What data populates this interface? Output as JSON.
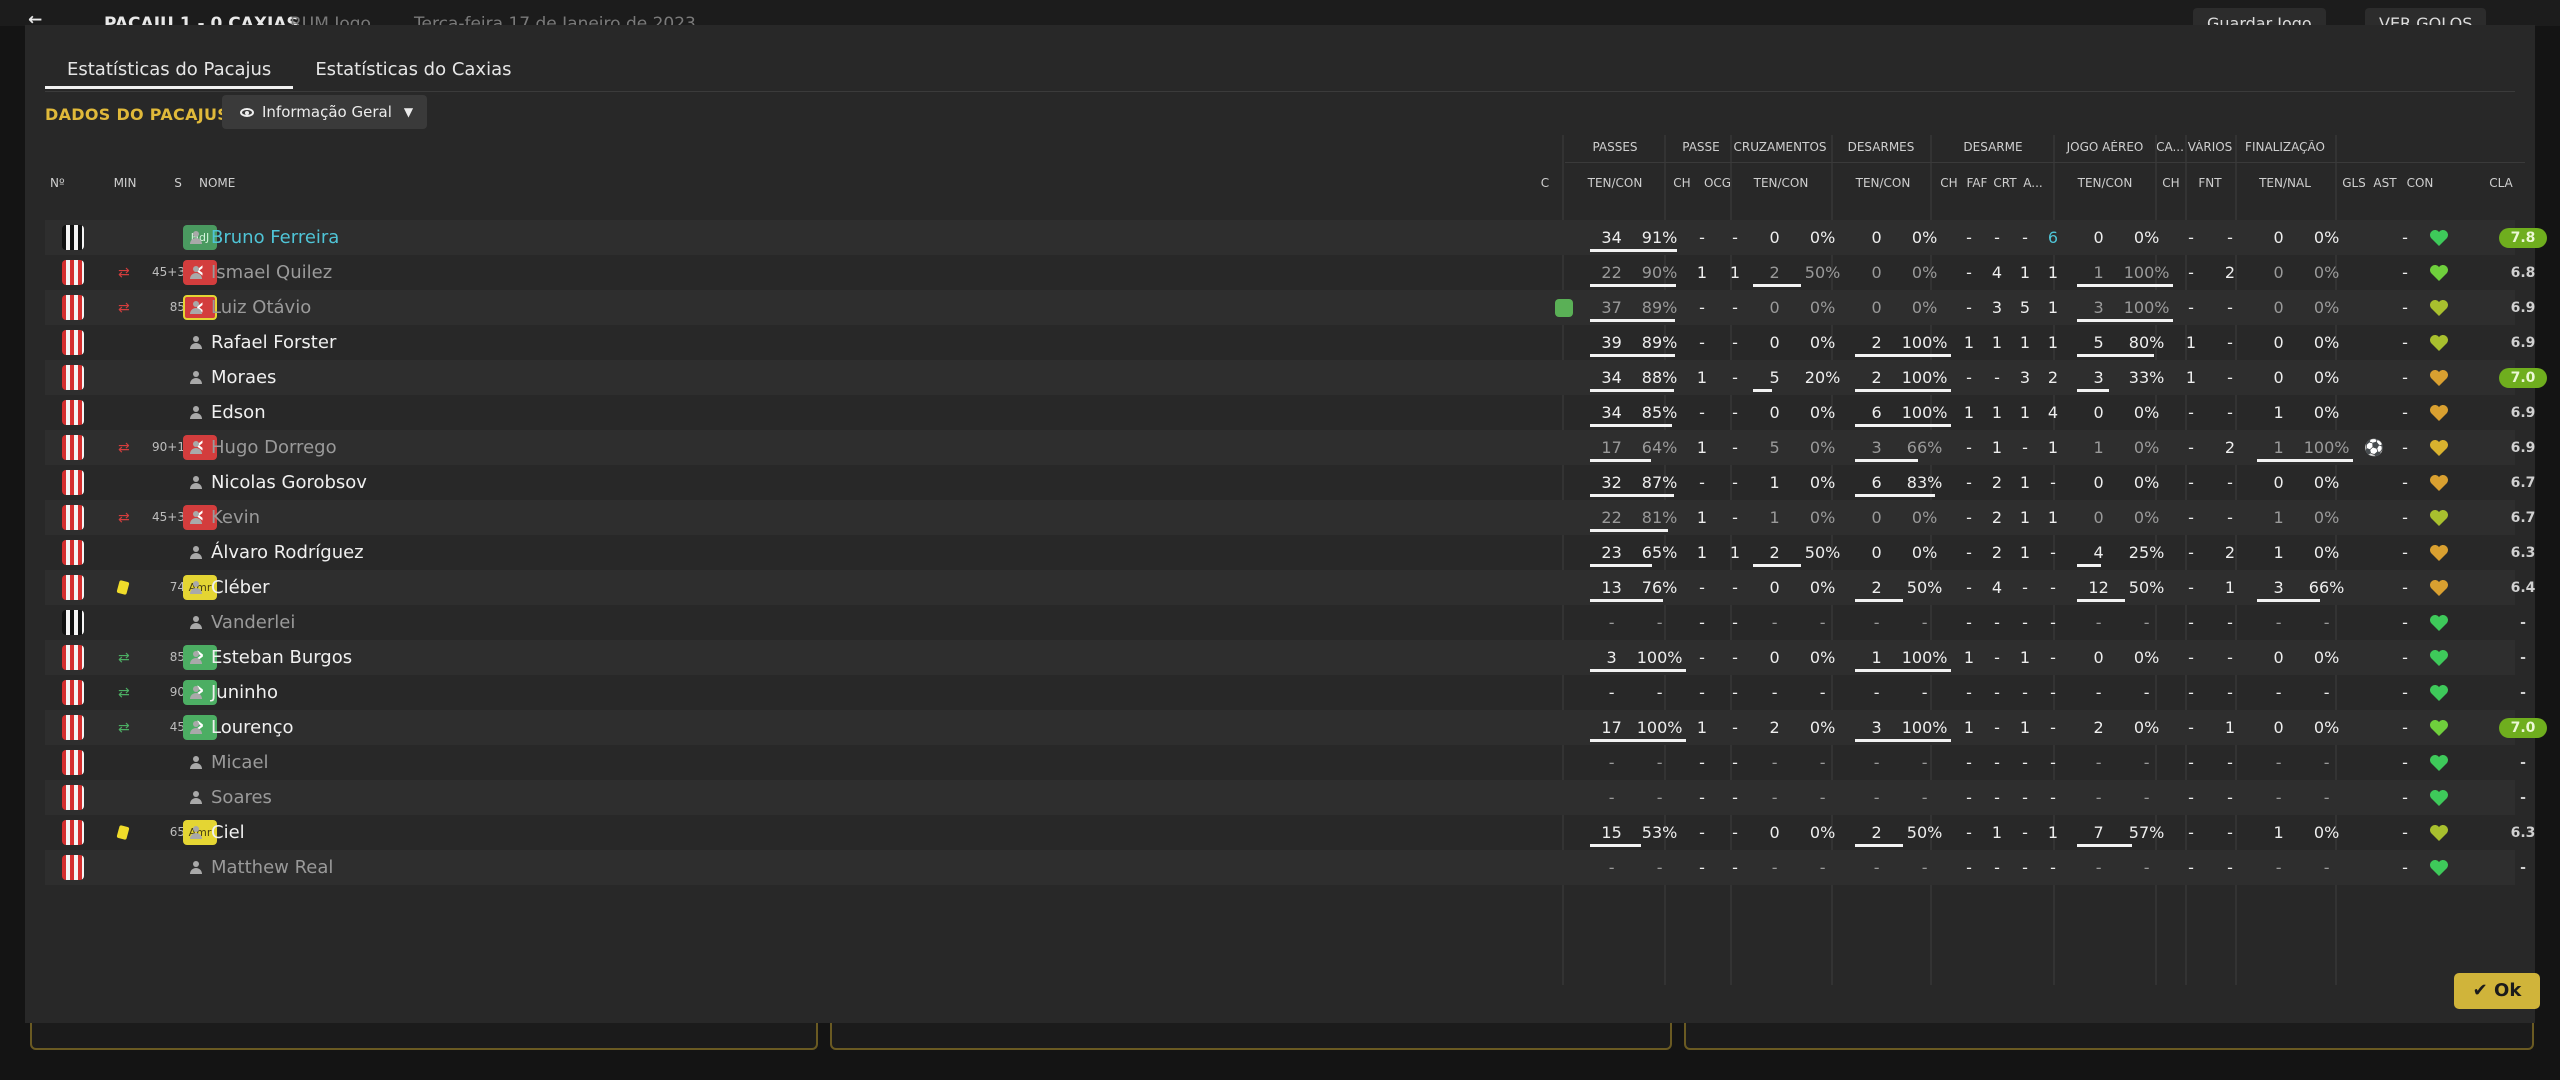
{
  "background": {
    "match_title": "PACAJU 1 - 0 CAXIAS",
    "match_sub": "RUM Jogo",
    "date": "Terça-feira 17 de Janeiro de 2023",
    "save_label": "Guardar Jogo",
    "goals_label": "VER GOLOS"
  },
  "tabs": [
    "Estatísticas do Pacajus",
    "Estatísticas do Caxias"
  ],
  "section_title": "DADOS DO PACAJUS",
  "view_dropdown": "Informação Geral",
  "groups": {
    "passes": "PASSES",
    "passe": "PASSE",
    "cruz": "CRUZAMENTOS",
    "desarmes": "DESARMES",
    "desarme": "DESARME",
    "aereo": "JOGO AÉREO",
    "ca": "CA...",
    "varios": "VÁRIOS",
    "final": "FINALIZAÇÃO"
  },
  "headers": {
    "no": "Nº",
    "min": "MIN",
    "s": "S",
    "nome": "NOME",
    "c": "C",
    "passes": "TEN/CON",
    "ch1": "CH",
    "ocg": "OCG",
    "cruz": "TEN/CON",
    "desarmes": "TEN/CON",
    "ch2": "CH",
    "faf": "FAF",
    "crt": "CRT",
    "a": "A...",
    "aereo": "TEN/CON",
    "ch3": "CH",
    "fnt": "FNT",
    "final": "TEN/NAL",
    "gls": "GLS",
    "ast": "AST",
    "con": "CON",
    "cla": "CLA"
  },
  "players": [
    {
      "name": "Bruno Ferreira",
      "kit": "bw",
      "evt": "",
      "min": "",
      "sb": "HdJ",
      "p": [
        "34",
        "91%"
      ],
      "pf": 0.91,
      "ch": "-",
      "ocg": "-",
      "cr": [
        "0",
        "0%"
      ],
      "crf": 0,
      "ds": [
        "0",
        "0%"
      ],
      "dsf": 0,
      "dch": "-",
      "faf": "-",
      "crt": "-",
      "a": "6",
      "ae": [
        "0",
        "0%"
      ],
      "aef": 0,
      "ca": "-",
      "fnt": "-",
      "fi": [
        "0",
        "0%"
      ],
      "fif": 0,
      "gls": "",
      "ast": "-",
      "heart": "#3ec95a",
      "cla": "7.8",
      "hi": true,
      "style": "link",
      "teal": true
    },
    {
      "name": "Ismael Quilez",
      "kit": "red",
      "evt": "sub",
      "min": "45+3",
      "sb": "out",
      "p": [
        "22",
        "90%"
      ],
      "pf": 0.9,
      "ch": "1",
      "ocg": "1",
      "cr": [
        "2",
        "50%"
      ],
      "crf": 0.5,
      "ds": [
        "0",
        "0%"
      ],
      "dsf": 0,
      "dch": "-",
      "faf": "4",
      "crt": "1",
      "a": "1",
      "ae": [
        "1",
        "100%"
      ],
      "aef": 1,
      "ca": "-",
      "fnt": "2",
      "fi": [
        "0",
        "0%"
      ],
      "fif": 0,
      "gls": "",
      "ast": "-",
      "heart": "#6fcf3c",
      "cla": "6.8",
      "style": "dim"
    },
    {
      "name": "Luiz Otávio",
      "kit": "red",
      "evt": "sub",
      "min": "85",
      "sb": "outy",
      "c": true,
      "p": [
        "37",
        "89%"
      ],
      "pf": 0.89,
      "ch": "-",
      "ocg": "-",
      "cr": [
        "0",
        "0%"
      ],
      "crf": 0,
      "ds": [
        "0",
        "0%"
      ],
      "dsf": 0,
      "dch": "-",
      "faf": "3",
      "crt": "5",
      "a": "1",
      "ae": [
        "3",
        "100%"
      ],
      "aef": 1,
      "ca": "-",
      "fnt": "-",
      "fi": [
        "0",
        "0%"
      ],
      "fif": 0,
      "gls": "",
      "ast": "-",
      "heart": "#a8c02e",
      "cla": "6.9",
      "style": "dim"
    },
    {
      "name": "Rafael Forster",
      "kit": "red",
      "evt": "",
      "min": "",
      "sb": "",
      "p": [
        "39",
        "89%"
      ],
      "pf": 0.89,
      "ch": "-",
      "ocg": "-",
      "cr": [
        "0",
        "0%"
      ],
      "crf": 0,
      "ds": [
        "2",
        "100%"
      ],
      "dsf": 1,
      "dch": "1",
      "faf": "1",
      "crt": "1",
      "a": "1",
      "ae": [
        "5",
        "80%"
      ],
      "aef": 0.8,
      "ca": "1",
      "fnt": "-",
      "fi": [
        "0",
        "0%"
      ],
      "fif": 0,
      "gls": "",
      "ast": "-",
      "heart": "#a8c02e",
      "cla": "6.9",
      "style": ""
    },
    {
      "name": "Moraes",
      "kit": "red",
      "evt": "",
      "min": "",
      "sb": "",
      "p": [
        "34",
        "88%"
      ],
      "pf": 0.88,
      "ch": "1",
      "ocg": "-",
      "cr": [
        "5",
        "20%"
      ],
      "crf": 0.2,
      "ds": [
        "2",
        "100%"
      ],
      "dsf": 1,
      "dch": "-",
      "faf": "-",
      "crt": "3",
      "a": "2",
      "ae": [
        "3",
        "33%"
      ],
      "aef": 0.33,
      "ca": "1",
      "fnt": "-",
      "fi": [
        "0",
        "0%"
      ],
      "fif": 0,
      "gls": "",
      "ast": "-",
      "heart": "#d9a030",
      "cla": "7.0",
      "hi": true,
      "style": ""
    },
    {
      "name": "Edson",
      "kit": "red",
      "evt": "",
      "min": "",
      "sb": "",
      "p": [
        "34",
        "85%"
      ],
      "pf": 0.85,
      "ch": "-",
      "ocg": "-",
      "cr": [
        "0",
        "0%"
      ],
      "crf": 0,
      "ds": [
        "6",
        "100%"
      ],
      "dsf": 1,
      "dch": "1",
      "faf": "1",
      "crt": "1",
      "a": "4",
      "ae": [
        "0",
        "0%"
      ],
      "aef": 0,
      "ca": "-",
      "fnt": "-",
      "fi": [
        "1",
        "0%"
      ],
      "fif": 0,
      "gls": "",
      "ast": "-",
      "heart": "#d9a030",
      "cla": "6.9",
      "style": ""
    },
    {
      "name": "Hugo Dorrego",
      "kit": "red",
      "evt": "sub",
      "min": "90+1",
      "sb": "out",
      "p": [
        "17",
        "64%"
      ],
      "pf": 0.64,
      "ch": "1",
      "ocg": "-",
      "cr": [
        "5",
        "0%"
      ],
      "crf": 0,
      "ds": [
        "3",
        "66%"
      ],
      "dsf": 0.66,
      "dch": "-",
      "faf": "1",
      "crt": "-",
      "a": "1",
      "ae": [
        "1",
        "0%"
      ],
      "aef": 0,
      "ca": "-",
      "fnt": "2",
      "fi": [
        "1",
        "100%"
      ],
      "fif": 1,
      "gls": "⚽",
      "ast": "-",
      "heart": "#d9b22e",
      "cla": "6.9",
      "style": "dim"
    },
    {
      "name": "Nicolas Gorobsov",
      "kit": "red",
      "evt": "",
      "min": "",
      "sb": "",
      "p": [
        "32",
        "87%"
      ],
      "pf": 0.87,
      "ch": "-",
      "ocg": "-",
      "cr": [
        "1",
        "0%"
      ],
      "crf": 0,
      "ds": [
        "6",
        "83%"
      ],
      "dsf": 0.83,
      "dch": "-",
      "faf": "2",
      "crt": "1",
      "a": "-",
      "ae": [
        "0",
        "0%"
      ],
      "aef": 0,
      "ca": "-",
      "fnt": "-",
      "fi": [
        "0",
        "0%"
      ],
      "fif": 0,
      "gls": "",
      "ast": "-",
      "heart": "#d9a030",
      "cla": "6.7",
      "style": ""
    },
    {
      "name": "Kevin",
      "kit": "red",
      "evt": "sub",
      "min": "45+3",
      "sb": "out",
      "p": [
        "22",
        "81%"
      ],
      "pf": 0.81,
      "ch": "1",
      "ocg": "-",
      "cr": [
        "1",
        "0%"
      ],
      "crf": 0,
      "ds": [
        "0",
        "0%"
      ],
      "dsf": 0,
      "dch": "-",
      "faf": "2",
      "crt": "1",
      "a": "1",
      "ae": [
        "0",
        "0%"
      ],
      "aef": 0,
      "ca": "-",
      "fnt": "-",
      "fi": [
        "1",
        "0%"
      ],
      "fif": 0,
      "gls": "",
      "ast": "-",
      "heart": "#a8c02e",
      "cla": "6.7",
      "style": "dim"
    },
    {
      "name": "Álvaro Rodríguez",
      "kit": "red",
      "evt": "",
      "min": "",
      "sb": "",
      "p": [
        "23",
        "65%"
      ],
      "pf": 0.65,
      "ch": "1",
      "ocg": "1",
      "cr": [
        "2",
        "50%"
      ],
      "crf": 0.5,
      "ds": [
        "0",
        "0%"
      ],
      "dsf": 0,
      "dch": "-",
      "faf": "2",
      "crt": "1",
      "a": "-",
      "ae": [
        "4",
        "25%"
      ],
      "aef": 0.25,
      "ca": "-",
      "fnt": "2",
      "fi": [
        "1",
        "0%"
      ],
      "fif": 0,
      "gls": "",
      "ast": "-",
      "heart": "#d9a030",
      "cla": "6.3",
      "style": ""
    },
    {
      "name": "Cléber",
      "kit": "red",
      "evt": "yellow",
      "min": "74",
      "sb": "Amr",
      "p": [
        "13",
        "76%"
      ],
      "pf": 0.76,
      "ch": "-",
      "ocg": "-",
      "cr": [
        "0",
        "0%"
      ],
      "crf": 0,
      "ds": [
        "2",
        "50%"
      ],
      "dsf": 0.5,
      "dch": "-",
      "faf": "4",
      "crt": "-",
      "a": "-",
      "ae": [
        "12",
        "50%"
      ],
      "aef": 0.5,
      "ca": "-",
      "fnt": "1",
      "fi": [
        "3",
        "66%"
      ],
      "fif": 0.66,
      "gls": "",
      "ast": "-",
      "heart": "#d9a030",
      "cla": "6.4",
      "style": ""
    },
    {
      "name": "Vanderlei",
      "kit": "bw",
      "evt": "",
      "min": "",
      "sb": "",
      "p": [
        "-",
        "-"
      ],
      "pf": 0,
      "ch": "-",
      "ocg": "-",
      "cr": [
        "-",
        "-"
      ],
      "crf": 0,
      "ds": [
        "-",
        "-"
      ],
      "dsf": 0,
      "dch": "-",
      "faf": "-",
      "crt": "-",
      "a": "-",
      "ae": [
        "-",
        "-"
      ],
      "aef": 0,
      "ca": "-",
      "fnt": "-",
      "fi": [
        "-",
        "-"
      ],
      "fif": 0,
      "gls": "",
      "ast": "-",
      "heart": "#3ec95a",
      "cla": "-",
      "style": "dim"
    },
    {
      "name": "Esteban Burgos",
      "kit": "red",
      "evt": "subin",
      "min": "85",
      "sb": "in",
      "p": [
        "3",
        "100%"
      ],
      "pf": 1,
      "ch": "-",
      "ocg": "-",
      "cr": [
        "0",
        "0%"
      ],
      "crf": 0,
      "ds": [
        "1",
        "100%"
      ],
      "dsf": 1,
      "dch": "1",
      "faf": "-",
      "crt": "1",
      "a": "-",
      "ae": [
        "0",
        "0%"
      ],
      "aef": 0,
      "ca": "-",
      "fnt": "-",
      "fi": [
        "0",
        "0%"
      ],
      "fif": 0,
      "gls": "",
      "ast": "-",
      "heart": "#3ec95a",
      "cla": "-",
      "style": ""
    },
    {
      "name": "Juninho",
      "kit": "red",
      "evt": "subin",
      "min": "90",
      "sb": "in",
      "p": [
        "-",
        "-"
      ],
      "pf": 0,
      "ch": "-",
      "ocg": "-",
      "cr": [
        "-",
        "-"
      ],
      "crf": 0,
      "ds": [
        "-",
        "-"
      ],
      "dsf": 0,
      "dch": "-",
      "faf": "-",
      "crt": "-",
      "a": "-",
      "ae": [
        "-",
        "-"
      ],
      "aef": 0,
      "ca": "-",
      "fnt": "-",
      "fi": [
        "-",
        "-"
      ],
      "fif": 0,
      "gls": "",
      "ast": "-",
      "heart": "#3ec95a",
      "cla": "-",
      "style": ""
    },
    {
      "name": "Lourenço",
      "kit": "red",
      "evt": "subin",
      "min": "45",
      "sb": "in",
      "p": [
        "17",
        "100%"
      ],
      "pf": 1,
      "ch": "1",
      "ocg": "-",
      "cr": [
        "2",
        "0%"
      ],
      "crf": 0,
      "ds": [
        "3",
        "100%"
      ],
      "dsf": 1,
      "dch": "1",
      "faf": "-",
      "crt": "1",
      "a": "-",
      "ae": [
        "2",
        "0%"
      ],
      "aef": 0,
      "ca": "-",
      "fnt": "1",
      "fi": [
        "0",
        "0%"
      ],
      "fif": 0,
      "gls": "",
      "ast": "-",
      "heart": "#6fcf3c",
      "cla": "7.0",
      "hi": true,
      "style": ""
    },
    {
      "name": "Micael",
      "kit": "red",
      "evt": "",
      "min": "",
      "sb": "",
      "p": [
        "-",
        "-"
      ],
      "pf": 0,
      "ch": "-",
      "ocg": "-",
      "cr": [
        "-",
        "-"
      ],
      "crf": 0,
      "ds": [
        "-",
        "-"
      ],
      "dsf": 0,
      "dch": "-",
      "faf": "-",
      "crt": "-",
      "a": "-",
      "ae": [
        "-",
        "-"
      ],
      "aef": 0,
      "ca": "-",
      "fnt": "-",
      "fi": [
        "-",
        "-"
      ],
      "fif": 0,
      "gls": "",
      "ast": "-",
      "heart": "#3ec95a",
      "cla": "-",
      "style": "dim"
    },
    {
      "name": "Soares",
      "kit": "red",
      "evt": "",
      "min": "",
      "sb": "",
      "p": [
        "-",
        "-"
      ],
      "pf": 0,
      "ch": "-",
      "ocg": "-",
      "cr": [
        "-",
        "-"
      ],
      "crf": 0,
      "ds": [
        "-",
        "-"
      ],
      "dsf": 0,
      "dch": "-",
      "faf": "-",
      "crt": "-",
      "a": "-",
      "ae": [
        "-",
        "-"
      ],
      "aef": 0,
      "ca": "-",
      "fnt": "-",
      "fi": [
        "-",
        "-"
      ],
      "fif": 0,
      "gls": "",
      "ast": "-",
      "heart": "#3ec95a",
      "cla": "-",
      "style": "dim"
    },
    {
      "name": "Ciel",
      "kit": "red",
      "evt": "yellow",
      "min": "65",
      "sb": "Amr",
      "p": [
        "15",
        "53%"
      ],
      "pf": 0.53,
      "ch": "-",
      "ocg": "-",
      "cr": [
        "0",
        "0%"
      ],
      "crf": 0,
      "ds": [
        "2",
        "50%"
      ],
      "dsf": 0.5,
      "dch": "-",
      "faf": "1",
      "crt": "-",
      "a": "1",
      "ae": [
        "7",
        "57%"
      ],
      "aef": 0.57,
      "ca": "-",
      "fnt": "-",
      "fi": [
        "1",
        "0%"
      ],
      "fif": 0,
      "gls": "",
      "ast": "-",
      "heart": "#a8c02e",
      "cla": "6.3",
      "style": ""
    },
    {
      "name": "Matthew Real",
      "kit": "red",
      "evt": "",
      "min": "",
      "sb": "",
      "p": [
        "-",
        "-"
      ],
      "pf": 0,
      "ch": "-",
      "ocg": "-",
      "cr": [
        "-",
        "-"
      ],
      "crf": 0,
      "ds": [
        "-",
        "-"
      ],
      "dsf": 0,
      "dch": "-",
      "faf": "-",
      "crt": "-",
      "a": "-",
      "ae": [
        "-",
        "-"
      ],
      "aef": 0,
      "ca": "-",
      "fnt": "-",
      "fi": [
        "-",
        "-"
      ],
      "fif": 0,
      "gls": "",
      "ast": "-",
      "heart": "#3ec95a",
      "cla": "-",
      "style": "dim"
    }
  ],
  "ok_label": "Ok"
}
